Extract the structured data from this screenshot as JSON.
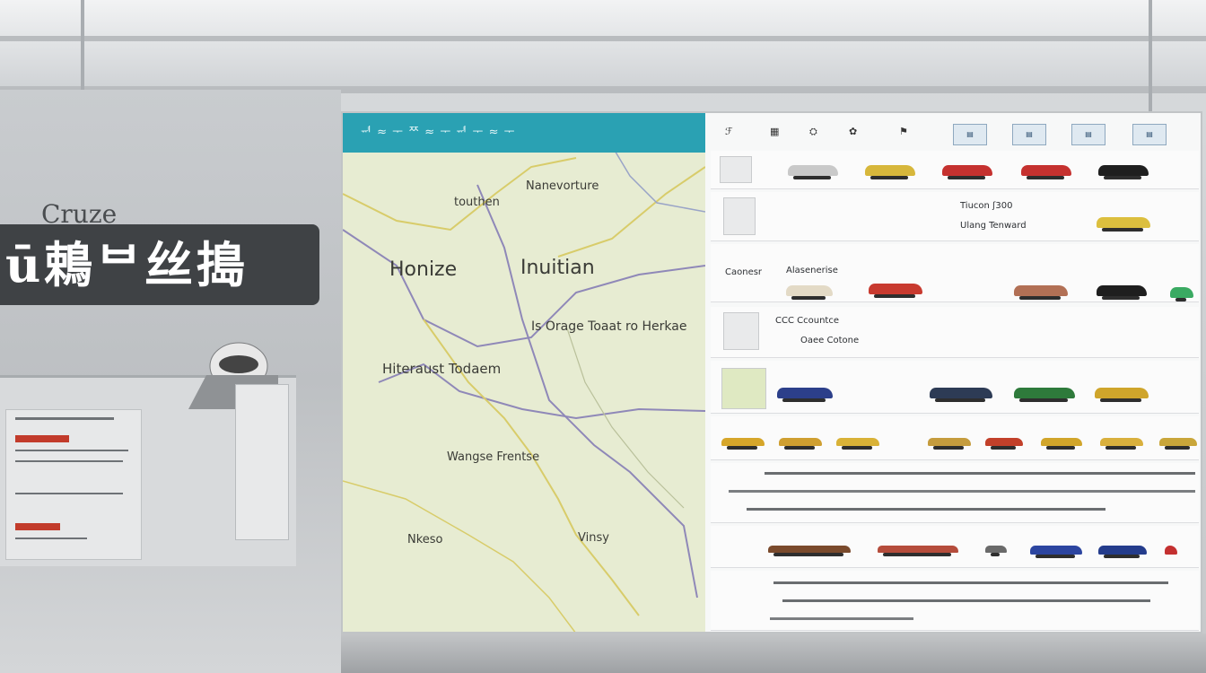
{
  "scene": {
    "brand_text": "Cruze",
    "sign_text": "ū鵣ᄇ丝搗"
  },
  "map": {
    "header": "ᆑ ≈ ᅮ ᄍ ≈ ᅮ ᆑ ᅮ ≈ ᅮ",
    "labels": [
      {
        "text": "Honize",
        "size": "big"
      },
      {
        "text": "Inuitian",
        "size": "big"
      },
      {
        "text": "touthen",
        "size": "small"
      },
      {
        "text": "Nanevorture",
        "size": "small"
      },
      {
        "text": "Hiteraust Todaem",
        "size": "med"
      },
      {
        "text": "Is Orage Toaat ro Herkae",
        "size": "med"
      },
      {
        "text": "Wangse Frentse",
        "size": "med"
      },
      {
        "text": "Nkeso",
        "size": "med"
      },
      {
        "text": "Vinsy",
        "size": "med"
      }
    ]
  },
  "list": {
    "header_items": [
      "ℱ",
      "▦",
      "⛭",
      "✿",
      "⚑",
      "▤",
      "▤",
      "▤",
      "▤"
    ],
    "rows": [
      {
        "title": "",
        "subtitle": "",
        "cars": [
          "#c9c9c9",
          "#d7b73b",
          "#c5312f",
          "#c5312f",
          "#1f1f1f"
        ]
      },
      {
        "title": "Tiucon ʃ300",
        "subtitle": "Ulang Tenward",
        "cars": [
          "#dcbf3e"
        ]
      },
      {
        "title": "Caonesr",
        "subtitle": "Alasenerise",
        "cars": [
          "#e3dac6",
          "#c83a2f",
          "#b27055",
          "#1e1e1e",
          "#3aaa62"
        ]
      },
      {
        "title": "CCC Ccountce",
        "subtitle": "Oaee Cotone",
        "cars": []
      },
      {
        "title": "",
        "subtitle": "",
        "cars": [
          "#2c3f8a",
          "#2d3b55",
          "#2e7a3b",
          "#cfa52b"
        ]
      },
      {
        "title": "",
        "subtitle": "",
        "cars": [
          "#d6a62a",
          "#cf9f30",
          "#d9b237",
          "#c59c3d",
          "#c2402a",
          "#d1a52a",
          "#d9b03d",
          "#c9a63a"
        ]
      },
      {
        "title": "",
        "subtitle": "",
        "cars": []
      },
      {
        "title": "",
        "subtitle": "",
        "cars": [
          "#7a4a2c",
          "#b54c3b",
          "#6a6a6a",
          "#2c45a0",
          "#243c8c",
          "#c43030"
        ]
      },
      {
        "title": "",
        "subtitle": "",
        "cars": []
      }
    ]
  },
  "colors": {
    "map_header": "#2aa1b3",
    "sign_bg": "#3f4245",
    "map_bg": "#e7ecd2"
  }
}
